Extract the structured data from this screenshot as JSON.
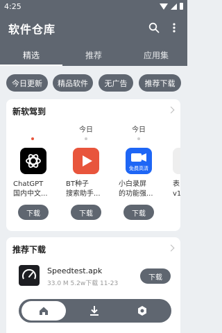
{
  "status_bar": {
    "time": "4:25"
  },
  "app_title": "软件仓库",
  "tabs": [
    {
      "label": "精选",
      "active": true
    },
    {
      "label": "推荐",
      "active": false
    },
    {
      "label": "应用集",
      "active": false
    }
  ],
  "chips": [
    "今日更新",
    "精品软件",
    "无广告",
    "推荐下载"
  ],
  "new_apps": {
    "title": "新软驾到",
    "dates": [
      "今日",
      "今日"
    ],
    "apps": [
      {
        "name_line1": "ChatGPT",
        "name_line2": "国内中文...",
        "button": "下载"
      },
      {
        "name_line1": "BT种子",
        "name_line2": "搜索助手...",
        "button": "下载"
      },
      {
        "name_line1": "小白录屏",
        "name_line2": "的功能强...",
        "button": "下载"
      },
      {
        "name_line1": "表",
        "name_line2": "v1",
        "button": ""
      }
    ],
    "recorder_badge": "免费高清"
  },
  "recommend": {
    "title": "推荐下载",
    "items": [
      {
        "name": "Speedtest.apk",
        "meta": "33.0 M  5.2w下载  11-23",
        "button": "下载"
      }
    ]
  },
  "bottom_nav": [
    "home-icon",
    "download-icon",
    "settings-icon"
  ],
  "colors": {
    "primary": "#5f6670",
    "accent_red": "#e8553c",
    "blue": "#1e66f5"
  }
}
